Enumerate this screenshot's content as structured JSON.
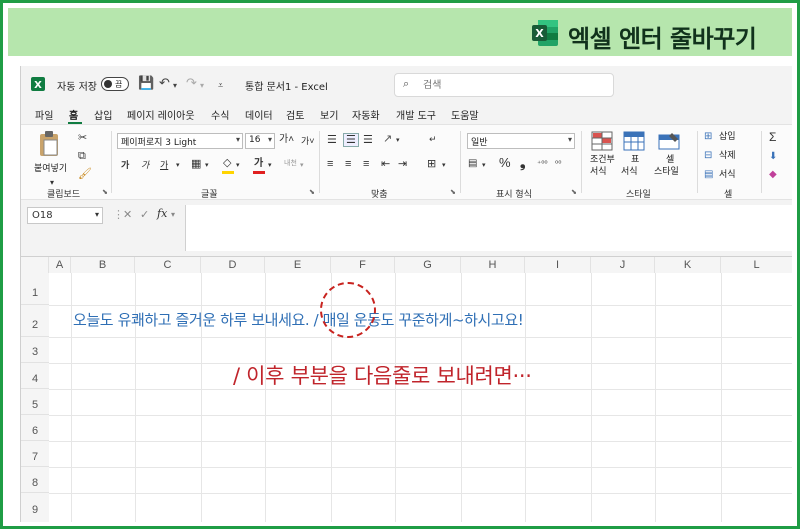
{
  "banner": {
    "title": "엑셀 엔터 줄바꾸기",
    "logo_icon": "excel-logo-icon"
  },
  "window": {
    "autosave_label": "자동 저장",
    "autosave_state": "끔",
    "doc_title": "통합 문서1 - Excel",
    "search_placeholder": "검색"
  },
  "menu": {
    "tabs": [
      "파일",
      "홈",
      "삽입",
      "페이지 레이아웃",
      "수식",
      "데이터",
      "검토",
      "보기",
      "자동화",
      "개발 도구",
      "도움말"
    ],
    "active": "홈"
  },
  "ribbon": {
    "clipboard": {
      "paste": "붙여넣기",
      "group": "클립보드"
    },
    "font": {
      "name": "페이퍼로지 3 Light",
      "size": "16",
      "group": "글꼴"
    },
    "align": {
      "group": "맞춤"
    },
    "number": {
      "format": "일반",
      "group": "표시 형식"
    },
    "style": {
      "cond": "조건부",
      "cond2": "서식",
      "table": "표",
      "table2": "서식",
      "cell": "셀",
      "cell2": "스타일",
      "group": "스타일"
    },
    "cells": {
      "insert": "삽입",
      "delete": "삭제",
      "format": "서식",
      "group": "셀"
    }
  },
  "formula_bar": {
    "name_box": "O18",
    "fx": "fx",
    "value": ""
  },
  "sheet": {
    "columns": [
      "A",
      "B",
      "C",
      "D",
      "E",
      "F",
      "G",
      "H",
      "I",
      "J",
      "K",
      "L"
    ],
    "rows": [
      "1",
      "2",
      "3",
      "4",
      "5",
      "6",
      "7",
      "8",
      "9"
    ],
    "b2_text": "오늘도 유쾌하고 즐거운 하루 보내세요.  / 매일 운동도 꾸준하게~하시고요!"
  },
  "annotation": "/ 이후 부분을 다음줄로 보내려면···",
  "colors": {
    "frame": "#1f9d45",
    "banner": "#b6e6ad",
    "cell_text": "#2f6fb5",
    "annotation": "#c0242b"
  }
}
